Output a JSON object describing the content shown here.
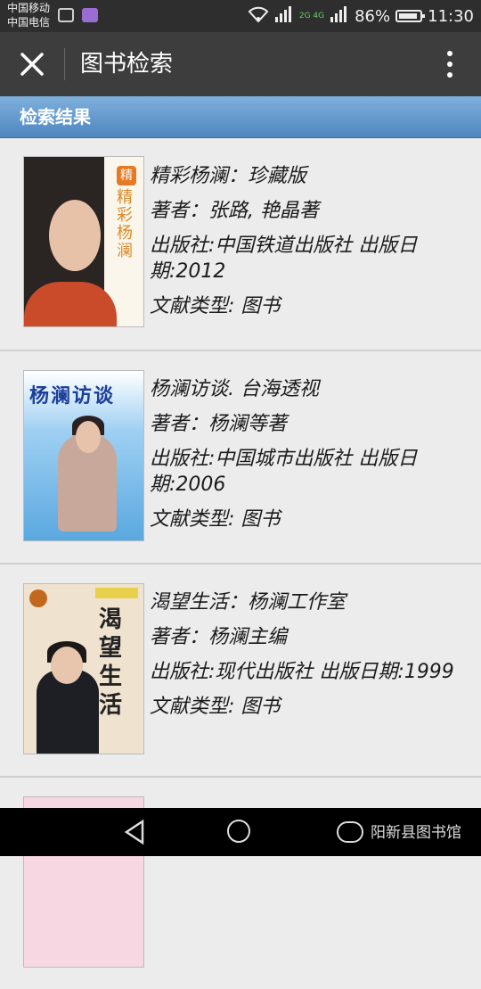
{
  "status_bar": {
    "carrier_1": "中国移动",
    "carrier_2": "中国电信",
    "network_label": "2G 4G",
    "battery": "86%",
    "time": "11:30"
  },
  "header": {
    "title": "图书检索"
  },
  "results": {
    "header_label": "检索结果",
    "books": [
      {
        "title": "精彩杨澜：珍藏版",
        "author": "著者：张路, 艳晶著",
        "publisher": "出版社:中国铁道出版社 出版日期:2012",
        "type": "文献类型:   图书",
        "cover_text": "精彩杨澜"
      },
      {
        "title": "杨澜访谈. 台海透视",
        "author": "著者：杨澜等著",
        "publisher": "出版社:中国城市出版社 出版日期:2006",
        "type": "文献类型:   图书",
        "cover_text": "杨澜访谈"
      },
      {
        "title": "渴望生活：杨澜工作室",
        "author": "著者：杨澜主编",
        "publisher": "出版社:现代出版社 出版日期:1999",
        "type": "文献类型:   图书",
        "cover_text": "渴望生活"
      }
    ]
  },
  "footer": {
    "watermark": "阳新县图书馆"
  },
  "colors": {
    "accent": "#4f86c0",
    "titlebar": "#3d3d3d",
    "statusbar": "#2e2e2e"
  }
}
